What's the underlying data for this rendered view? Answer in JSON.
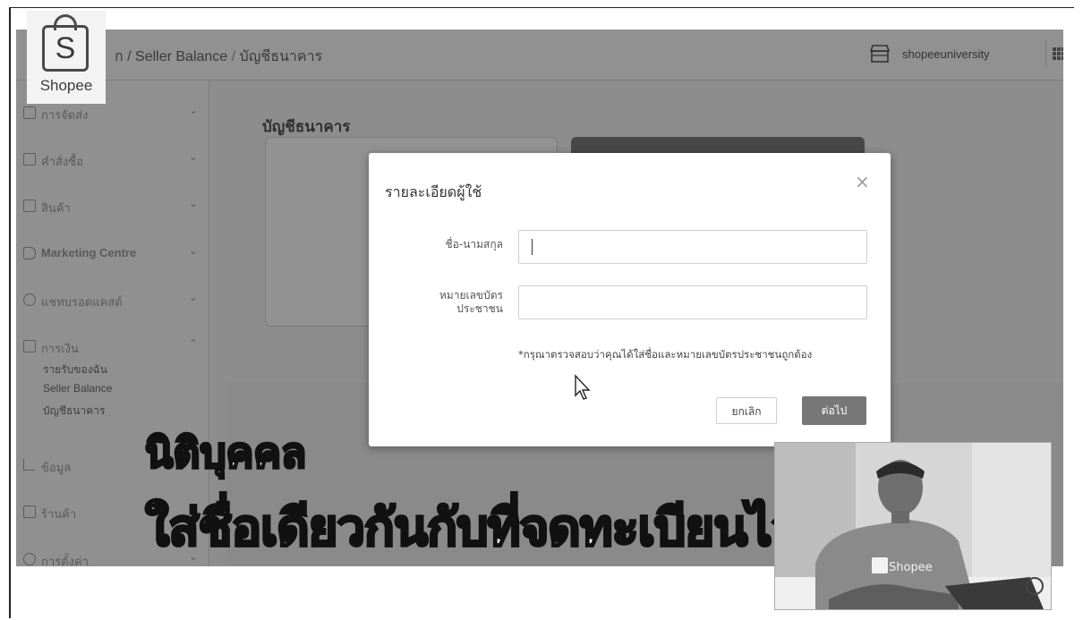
{
  "breadcrumb": {
    "home": "ก / ",
    "seller_balance": "Seller Balance",
    "separator": " / ",
    "current": "บัญชีธนาคาร"
  },
  "shop": {
    "name": "shopeeuniversity"
  },
  "logo": {
    "letter": "S",
    "word": "Shopee"
  },
  "sidebar": {
    "items": [
      {
        "label": "การจัดส่ง",
        "icon": "truck-icon",
        "chevron": "⌄"
      },
      {
        "label": "คำสั่งซื้อ",
        "icon": "order-icon",
        "chevron": "⌄"
      },
      {
        "label": "สินค้า",
        "icon": "product-icon",
        "chevron": "⌄"
      },
      {
        "label": "Marketing Centre",
        "icon": "tag-icon",
        "chevron": "⌄"
      },
      {
        "label": "แชทบรอดแคสต์",
        "icon": "broadcast-icon",
        "chevron": "⌄"
      },
      {
        "label": "การเงิน",
        "icon": "wallet-icon",
        "chevron": "⌃"
      },
      {
        "label": "ข้อมูล",
        "icon": "chart-icon",
        "chevron": ""
      },
      {
        "label": "ร้านค้า",
        "icon": "store-icon",
        "chevron": ""
      },
      {
        "label": "การตั้งค่า",
        "icon": "settings-icon",
        "chevron": "⌄"
      }
    ],
    "finance_sub": [
      "รายรับของฉัน",
      "Seller Balance",
      "บัญชีธนาคาร"
    ]
  },
  "main": {
    "title": "บัญชีธนาคาร"
  },
  "modal": {
    "title": "รายละเอียดผู้ใช้",
    "close": "×",
    "name_label": "ชื่อ-นามสกุล",
    "name_value": "",
    "id_label_line1": "หมายเลขบัตร",
    "id_label_line2": "ประชาชน",
    "id_value": "",
    "hint": "*กรุณาตรวจสอบว่าคุณได้ใส่ชื่อและหมายเลขบัตรประชาชนถูกต้อง",
    "cancel": "ยกเลิก",
    "next": "ต่อไป"
  },
  "captions": {
    "line1": "นิติบุคคล",
    "line2": "ใส่ชื่อเดียวกันกับที่จดทะเบียนไว้"
  },
  "video": {
    "shirt_text": "Shopee"
  }
}
